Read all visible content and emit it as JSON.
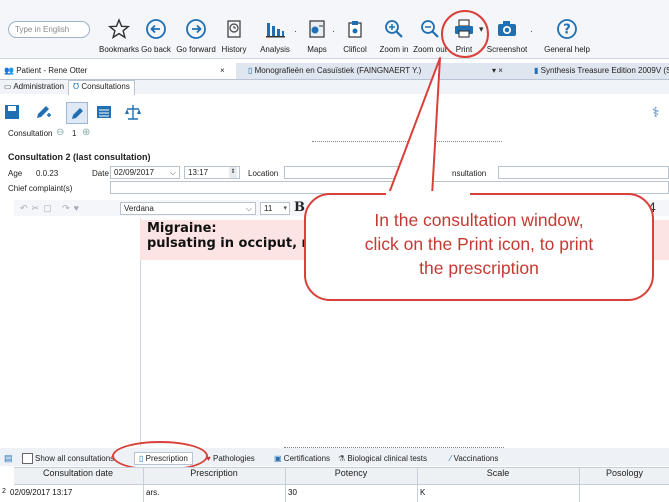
{
  "toolbar": {
    "search_placeholder": "Type in English",
    "buttons": [
      {
        "label": "Bookmarks"
      },
      {
        "label": "Go back"
      },
      {
        "label": "Go forward"
      },
      {
        "label": "History"
      },
      {
        "label": "Analysis"
      },
      {
        "label": "Maps"
      },
      {
        "label": "Clificol"
      },
      {
        "label": "Zoom in"
      },
      {
        "label": "Zoom out"
      },
      {
        "label": "Print"
      },
      {
        "label": "Screenshot"
      },
      {
        "label": "General help"
      }
    ]
  },
  "doc_tabs": [
    {
      "label": "Patient - Rene Otter",
      "close": "×"
    },
    {
      "label": "Monografieën en Casuïstiek (FAINGNAERT Y.)",
      "close": "▾ ×"
    },
    {
      "label": "Synthesis Treasure Edition 2009V (S"
    }
  ],
  "sub_tabs": [
    "Administration",
    "Consultations"
  ],
  "consultation": {
    "nav_label": "Consultation",
    "nav_number": "1",
    "title": "Consultation 2 (last consultation)",
    "age_label": "Age",
    "age_value": "0.0.23",
    "date_label": "Date",
    "date_value": "02/09/2017",
    "time_value": "13:17",
    "location_label": "Location",
    "type_label": "nsultation",
    "chief_label": "Chief complaint(s)"
  },
  "editor": {
    "font_name": "Verdana",
    "font_size": "11",
    "bold_label": "B",
    "right_digit": "4",
    "note_line1": "Migraine:",
    "note_line2": "pulsating in occiput, m"
  },
  "callout": {
    "line1": "In the consultation window,",
    "line2": "click on the Print icon, to print",
    "line3": "the prescription"
  },
  "bottom_tabs": {
    "show_all_label": "Show all consultations",
    "tabs": [
      "Prescription",
      "Pathologies",
      "Certifications",
      "Biological clinical tests",
      "Vaccinations"
    ]
  },
  "grid": {
    "headers": [
      "Consultation date",
      "Prescription",
      "Potency",
      "Scale",
      "Posology"
    ],
    "rows": [
      {
        "num": "2",
        "date": "02/09/2017 13:17",
        "prescription": "ars.",
        "potency": "30",
        "scale": "K"
      }
    ]
  },
  "colors": {
    "accent": "#1f6fb2",
    "callout_red": "#d9403a",
    "note_bg": "#fde4e4"
  }
}
